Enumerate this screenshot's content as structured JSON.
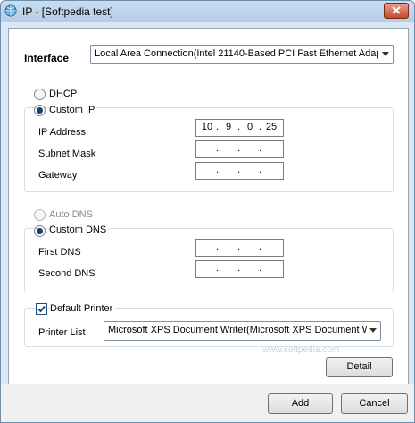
{
  "window": {
    "title": "IP - [Softpedia test]"
  },
  "interface": {
    "label": "Interface",
    "selected": "Local Area Connection(Intel 21140-Based PCI Fast Ethernet Adapt"
  },
  "ip": {
    "dhcp_label": "DHCP",
    "custom_label": "Custom IP",
    "ip_label": "IP Address",
    "ip_value": [
      "10",
      "9",
      "0",
      "25"
    ],
    "subnet_label": "Subnet Mask",
    "gateway_label": "Gateway"
  },
  "dns": {
    "auto_label": "Auto DNS",
    "custom_label": "Custom DNS",
    "first_label": "First DNS",
    "second_label": "Second DNS"
  },
  "printer": {
    "default_label": "Default Printer",
    "list_label": "Printer List",
    "selected": "Microsoft XPS Document Writer(Microsoft XPS Document W"
  },
  "buttons": {
    "detail": "Detail",
    "add": "Add",
    "cancel": "Cancel"
  },
  "watermark": "www.softpedia.com"
}
